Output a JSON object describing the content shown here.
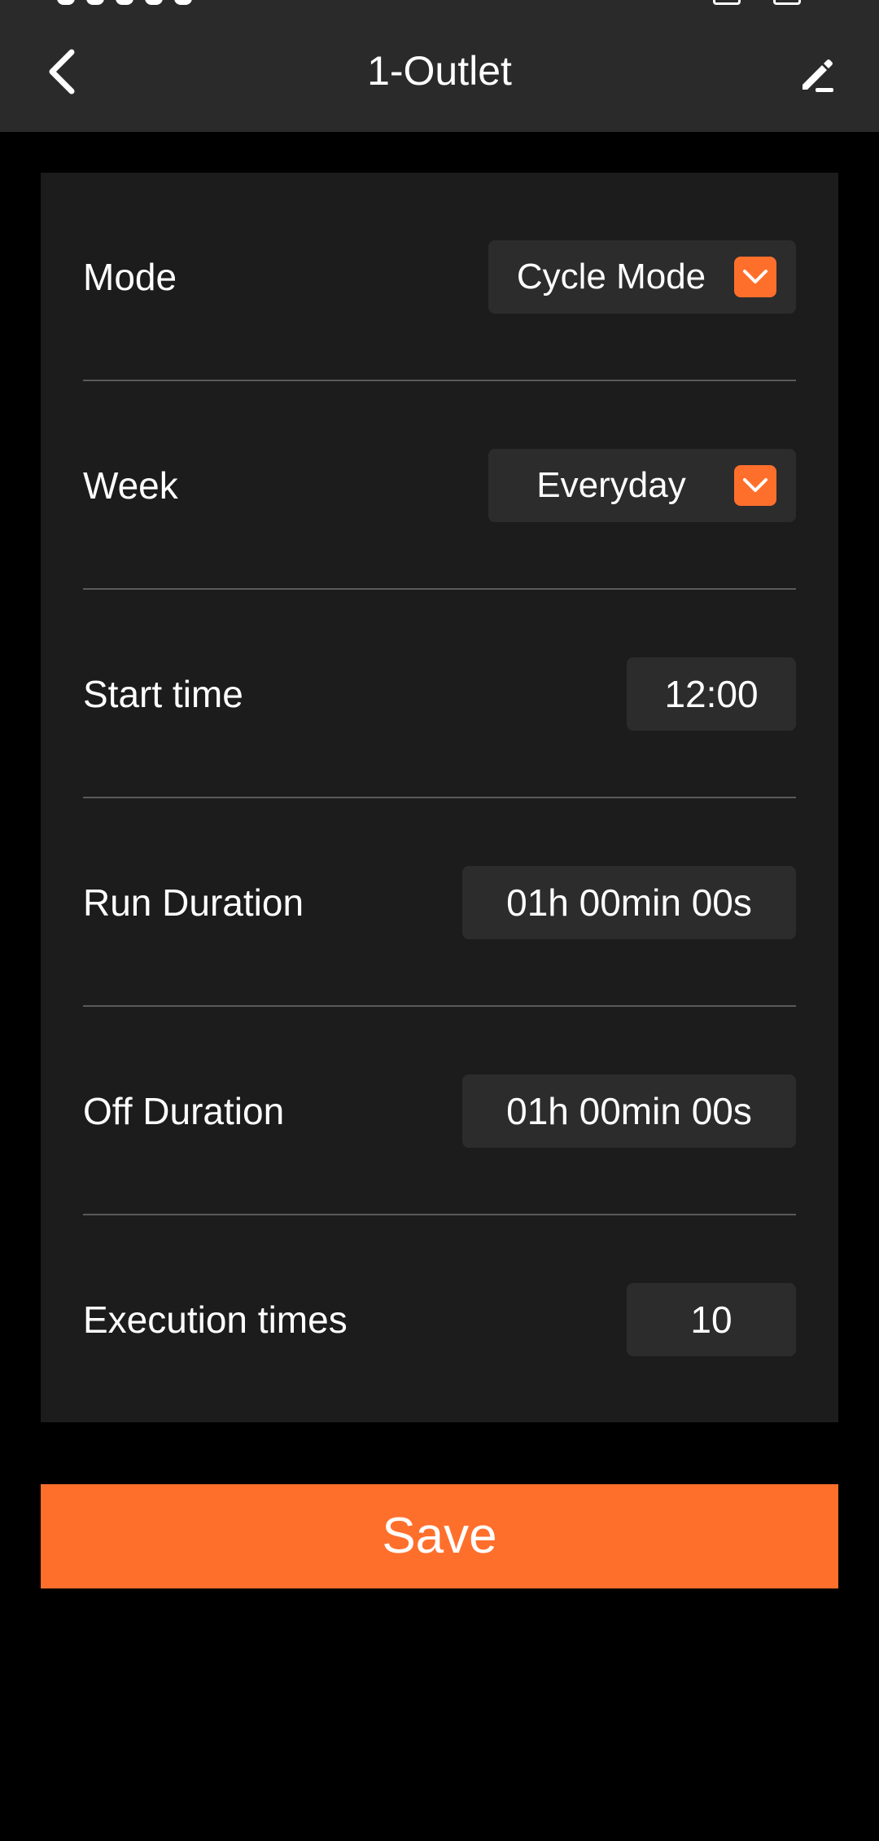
{
  "header": {
    "title": "1-Outlet",
    "back_icon": "chevron-left-icon",
    "edit_icon": "pencil-icon"
  },
  "form": {
    "mode": {
      "label": "Mode",
      "value": "Cycle Mode"
    },
    "week": {
      "label": "Week",
      "value": "Everyday"
    },
    "start_time": {
      "label": "Start time",
      "value": "12:00"
    },
    "run_duration": {
      "label": "Run Duration",
      "value": "01h 00min 00s"
    },
    "off_duration": {
      "label": "Off Duration",
      "value": "01h 00min 00s"
    },
    "execution_times": {
      "label": "Execution times",
      "value": "10"
    }
  },
  "save_label": "Save",
  "colors": {
    "accent": "#ff6f2c",
    "header_bg": "#2a2a2a",
    "panel_bg": "#1c1c1c",
    "control_bg": "#2c2c2c",
    "page_bg": "#000000"
  }
}
